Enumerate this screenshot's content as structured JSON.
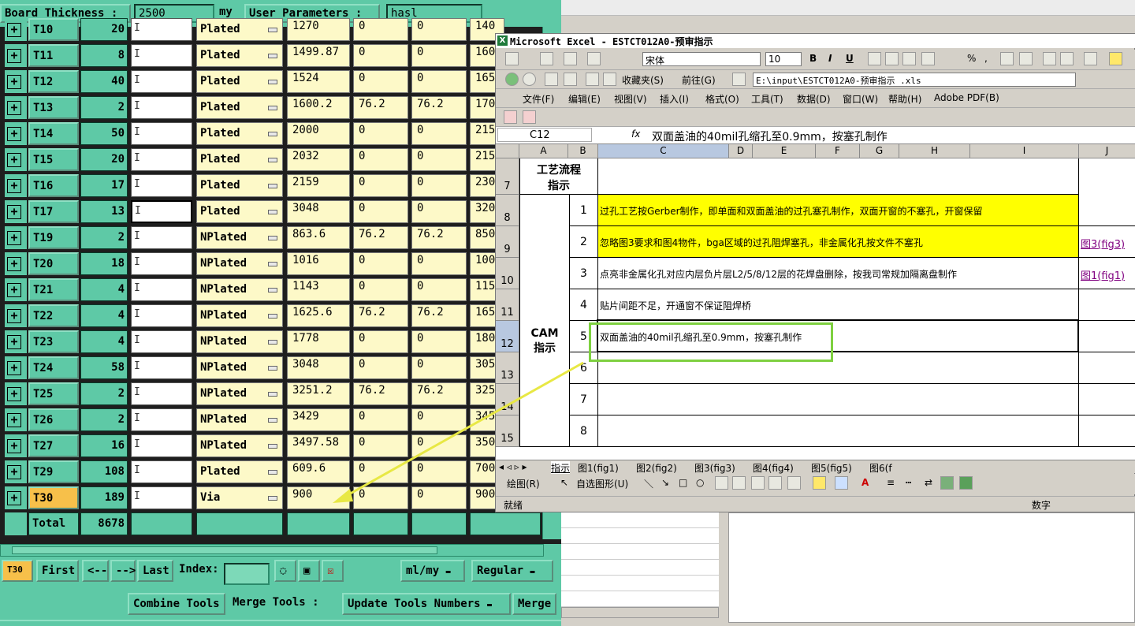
{
  "topbar": {
    "board_thickness_label": "Board Thickness :",
    "board_thickness_value": "2500",
    "unit": "my",
    "user_params_label": "User Parameters :",
    "user_params_value": "hasl"
  },
  "tools": [
    {
      "name": "T10",
      "count": "20",
      "type": "Plated",
      "v1": "1270",
      "v2": "0",
      "v3": "0",
      "v4": "140"
    },
    {
      "name": "T11",
      "count": "8",
      "type": "Plated",
      "v1": "1499.87",
      "v2": "0",
      "v3": "0",
      "v4": "160"
    },
    {
      "name": "T12",
      "count": "40",
      "type": "Plated",
      "v1": "1524",
      "v2": "0",
      "v3": "0",
      "v4": "165"
    },
    {
      "name": "T13",
      "count": "2",
      "type": "Plated",
      "v1": "1600.2",
      "v2": "76.2",
      "v3": "76.2",
      "v4": "170"
    },
    {
      "name": "T14",
      "count": "50",
      "type": "Plated",
      "v1": "2000",
      "v2": "0",
      "v3": "0",
      "v4": "215"
    },
    {
      "name": "T15",
      "count": "20",
      "type": "Plated",
      "v1": "2032",
      "v2": "0",
      "v3": "0",
      "v4": "215"
    },
    {
      "name": "T16",
      "count": "17",
      "type": "Plated",
      "v1": "2159",
      "v2": "0",
      "v3": "0",
      "v4": "230"
    },
    {
      "name": "T17",
      "count": "13",
      "type": "Plated",
      "v1": "3048",
      "v2": "0",
      "v3": "0",
      "v4": "320"
    },
    {
      "name": "T19",
      "count": "2",
      "type": "NPlated",
      "v1": "863.6",
      "v2": "76.2",
      "v3": "76.2",
      "v4": "850"
    },
    {
      "name": "T20",
      "count": "18",
      "type": "NPlated",
      "v1": "1016",
      "v2": "0",
      "v3": "0",
      "v4": "100"
    },
    {
      "name": "T21",
      "count": "4",
      "type": "NPlated",
      "v1": "1143",
      "v2": "0",
      "v3": "0",
      "v4": "115"
    },
    {
      "name": "T22",
      "count": "4",
      "type": "NPlated",
      "v1": "1625.6",
      "v2": "76.2",
      "v3": "76.2",
      "v4": "165"
    },
    {
      "name": "T23",
      "count": "4",
      "type": "NPlated",
      "v1": "1778",
      "v2": "0",
      "v3": "0",
      "v4": "180"
    },
    {
      "name": "T24",
      "count": "58",
      "type": "NPlated",
      "v1": "3048",
      "v2": "0",
      "v3": "0",
      "v4": "305"
    },
    {
      "name": "T25",
      "count": "2",
      "type": "NPlated",
      "v1": "3251.2",
      "v2": "76.2",
      "v3": "76.2",
      "v4": "325"
    },
    {
      "name": "T26",
      "count": "2",
      "type": "NPlated",
      "v1": "3429",
      "v2": "0",
      "v3": "0",
      "v4": "345"
    },
    {
      "name": "T27",
      "count": "16",
      "type": "NPlated",
      "v1": "3497.58",
      "v2": "0",
      "v3": "0",
      "v4": "350"
    },
    {
      "name": "T29",
      "count": "108",
      "type": "Plated",
      "v1": "609.6",
      "v2": "0",
      "v3": "0",
      "v4": "700"
    },
    {
      "name": "T30",
      "count": "189",
      "type": "Via",
      "v1": "900",
      "v2": "0",
      "v3": "0",
      "v4": "900"
    }
  ],
  "total": {
    "label": "Total",
    "count": "8678"
  },
  "nav": {
    "current": "T30",
    "first": "First",
    "prev": "<--",
    "next": "-->",
    "last": "Last",
    "index_label": "Index:",
    "units": "ml/my",
    "mode": "Regular"
  },
  "actions": {
    "combine": "Combine Tools",
    "merge_label": "Merge Tools :",
    "update": "Update Tools Numbers",
    "merge": "Merge"
  },
  "excel": {
    "title": "Microsoft Excel - ESTCT012A0-预审指示",
    "font": "宋体",
    "font_size": "10",
    "favorites": "收藏夹(S)",
    "goto": "前往(G)",
    "address": "E:\\input\\ESTCT012A0-预审指示 .xls",
    "menus": [
      "文件(F)",
      "编辑(E)",
      "视图(V)",
      "插入(I)",
      "格式(O)",
      "工具(T)",
      "数据(D)",
      "窗口(W)",
      "帮助(H)",
      "Adobe PDF(B)"
    ],
    "namebox": "C12",
    "fx": "fx",
    "formula": "双面盖油的40mil孔缩孔至0.9mm，按塞孔制作",
    "columns": [
      "A",
      "B",
      "C",
      "D",
      "E",
      "F",
      "G",
      "H",
      "I",
      "J"
    ],
    "rows": [
      "7",
      "8",
      "9",
      "10",
      "11",
      "12",
      "13",
      "14",
      "15"
    ],
    "header_title": "工艺流程\n指示",
    "cam_label": "CAM\n指示",
    "items": [
      {
        "n": "1",
        "text": "过孔工艺按Gerber制作，即单面和双面盖油的过孔塞孔制作，双面开窗的不塞孔，开窗保留",
        "link": ""
      },
      {
        "n": "2",
        "text": "忽略图3要求和图4物件，bga区域的过孔阻焊塞孔，非金属化孔按文件不塞孔",
        "link": "图3(fig3)"
      },
      {
        "n": "3",
        "text": "点亮非金属化孔对应内层负片层L2/5/8/12层的花焊盘删除，按我司常规加隔离盘制作",
        "link": "图1(fig1)"
      },
      {
        "n": "4",
        "text": "贴片间距不足，开通窗不保证阻焊桥",
        "link": ""
      },
      {
        "n": "5",
        "text": "双面盖油的40mil孔缩孔至0.9mm，按塞孔制作",
        "link": ""
      },
      {
        "n": "6",
        "text": "",
        "link": ""
      },
      {
        "n": "7",
        "text": "",
        "link": ""
      },
      {
        "n": "8",
        "text": "",
        "link": ""
      }
    ],
    "tabs": [
      "指示",
      "图1(fig1)",
      "图2(fig2)",
      "图3(fig3)",
      "图4(fig4)",
      "图5(fig5)",
      "图6(f"
    ],
    "drawing": "绘图(R)",
    "autoshape": "自选图形(U)",
    "status_ready": "就绪",
    "status_num": "数字"
  }
}
